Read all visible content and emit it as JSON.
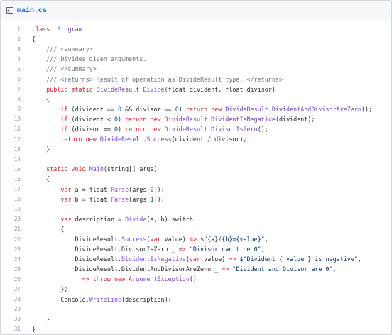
{
  "file": {
    "name": "main.cs",
    "icon": "code-file-icon"
  },
  "colors": {
    "keyword": "#cf222e",
    "type": "#6f42c1",
    "comment": "#6e7781",
    "string": "#0a3069",
    "line_number": "#8c959f"
  },
  "lines": [
    {
      "n": "1",
      "tokens": [
        [
          "kw",
          "class"
        ],
        [
          "",
          "  "
        ],
        [
          "ty",
          "Program"
        ]
      ]
    },
    {
      "n": "2",
      "tokens": [
        [
          "",
          "{"
        ]
      ]
    },
    {
      "n": "3",
      "tokens": [
        [
          "",
          "    "
        ],
        [
          "cm",
          "/// <summary>"
        ]
      ]
    },
    {
      "n": "4",
      "tokens": [
        [
          "",
          "    "
        ],
        [
          "cm",
          "/// Divides given arguments."
        ]
      ]
    },
    {
      "n": "5",
      "tokens": [
        [
          "",
          "    "
        ],
        [
          "cm",
          "/// </summary>"
        ]
      ]
    },
    {
      "n": "6",
      "tokens": [
        [
          "",
          "    "
        ],
        [
          "cm",
          "/// <returns> Result of operation as DivideResult type. </returns>"
        ]
      ]
    },
    {
      "n": "7",
      "tokens": [
        [
          "",
          "    "
        ],
        [
          "kw",
          "public static"
        ],
        [
          "",
          " "
        ],
        [
          "ty",
          "DivideResult"
        ],
        [
          "",
          " "
        ],
        [
          "fn",
          "Divide"
        ],
        [
          "",
          "(float divident, float divisor)"
        ]
      ]
    },
    {
      "n": "8",
      "tokens": [
        [
          "",
          "    {"
        ]
      ]
    },
    {
      "n": "9",
      "tokens": [
        [
          "",
          "        "
        ],
        [
          "kw",
          "if"
        ],
        [
          "",
          " (divident == "
        ],
        [
          "kw2",
          "0"
        ],
        [
          "",
          " && divisor == "
        ],
        [
          "kw2",
          "0"
        ],
        [
          "",
          ") "
        ],
        [
          "kw",
          "return new"
        ],
        [
          "",
          " "
        ],
        [
          "ty",
          "DivideResult"
        ],
        [
          "",
          "."
        ],
        [
          "ty",
          "DividentAndDivisorAreZero"
        ],
        [
          "",
          "();"
        ]
      ]
    },
    {
      "n": "10",
      "tokens": [
        [
          "",
          "        "
        ],
        [
          "kw",
          "if"
        ],
        [
          "",
          " (divident < "
        ],
        [
          "kw2",
          "0"
        ],
        [
          "",
          ") "
        ],
        [
          "kw",
          "return new"
        ],
        [
          "",
          " "
        ],
        [
          "ty",
          "DivideResult"
        ],
        [
          "",
          "."
        ],
        [
          "ty",
          "DividentIsNegative"
        ],
        [
          "",
          "(divident);"
        ]
      ]
    },
    {
      "n": "11",
      "tokens": [
        [
          "",
          "        "
        ],
        [
          "kw",
          "if"
        ],
        [
          "",
          " (divisor == "
        ],
        [
          "kw2",
          "0"
        ],
        [
          "",
          ") "
        ],
        [
          "kw",
          "return new"
        ],
        [
          "",
          " "
        ],
        [
          "ty",
          "DivideResult"
        ],
        [
          "",
          "."
        ],
        [
          "ty",
          "DivisorIsZero"
        ],
        [
          "",
          "();"
        ]
      ]
    },
    {
      "n": "12",
      "tokens": [
        [
          "",
          "        "
        ],
        [
          "kw",
          "return new"
        ],
        [
          "",
          " "
        ],
        [
          "ty",
          "DivideResult"
        ],
        [
          "",
          "."
        ],
        [
          "ty",
          "Success"
        ],
        [
          "",
          "(divident / divisor);"
        ]
      ]
    },
    {
      "n": "13",
      "tokens": [
        [
          "",
          "    }"
        ]
      ]
    },
    {
      "n": "14",
      "tokens": []
    },
    {
      "n": "15",
      "tokens": [
        [
          "",
          "    "
        ],
        [
          "kw",
          "static void"
        ],
        [
          "",
          " "
        ],
        [
          "fn",
          "Main"
        ],
        [
          "",
          "(string[] args)"
        ]
      ]
    },
    {
      "n": "16",
      "tokens": [
        [
          "",
          "    {"
        ]
      ]
    },
    {
      "n": "17",
      "tokens": [
        [
          "",
          "        "
        ],
        [
          "kw",
          "var"
        ],
        [
          "",
          " a = float."
        ],
        [
          "fn",
          "Parse"
        ],
        [
          "",
          "(args["
        ],
        [
          "kw2",
          "0"
        ],
        [
          "",
          "]);"
        ]
      ]
    },
    {
      "n": "18",
      "tokens": [
        [
          "",
          "        "
        ],
        [
          "kw",
          "var"
        ],
        [
          "",
          " b = float."
        ],
        [
          "fn",
          "Parse"
        ],
        [
          "",
          "(args["
        ],
        [
          "kw2",
          "1"
        ],
        [
          "",
          "]);"
        ]
      ]
    },
    {
      "n": "19",
      "tokens": []
    },
    {
      "n": "20",
      "tokens": [
        [
          "",
          "        "
        ],
        [
          "kw",
          "var"
        ],
        [
          "",
          " description = "
        ],
        [
          "fn",
          "Divide"
        ],
        [
          "",
          "(a, b) switch"
        ]
      ]
    },
    {
      "n": "21",
      "tokens": [
        [
          "",
          "        {"
        ]
      ]
    },
    {
      "n": "22",
      "tokens": [
        [
          "",
          "            DivideResult."
        ],
        [
          "fn",
          "Success"
        ],
        [
          "",
          "("
        ],
        [
          "kw",
          "var"
        ],
        [
          "",
          " value) "
        ],
        [
          "kw",
          "=>"
        ],
        [
          "",
          " "
        ],
        [
          "st",
          "$\"{a}/{b}={value}\""
        ],
        [
          "",
          ","
        ]
      ]
    },
    {
      "n": "23",
      "tokens": [
        [
          "",
          "            DivideResult.DivisorIsZero _ "
        ],
        [
          "kw",
          "=>"
        ],
        [
          "",
          " "
        ],
        [
          "st",
          "\"Divisor can't be 0\""
        ],
        [
          "",
          ","
        ]
      ]
    },
    {
      "n": "24",
      "tokens": [
        [
          "",
          "            DivideResult."
        ],
        [
          "fn",
          "DividentIsNegative"
        ],
        [
          "",
          "("
        ],
        [
          "kw",
          "var"
        ],
        [
          "",
          " value) "
        ],
        [
          "kw",
          "=>"
        ],
        [
          "",
          " "
        ],
        [
          "st",
          "$\"Divident { value } is negative\""
        ],
        [
          "",
          ","
        ]
      ]
    },
    {
      "n": "25",
      "tokens": [
        [
          "",
          "            DivideResult.DividentAndDivisorAreZero _ "
        ],
        [
          "kw",
          "=>"
        ],
        [
          "",
          " "
        ],
        [
          "st",
          "\"Divident and Divisor are 0\""
        ],
        [
          "",
          ","
        ]
      ]
    },
    {
      "n": "26",
      "tokens": [
        [
          "",
          "            _ "
        ],
        [
          "kw",
          "=> throw new"
        ],
        [
          "",
          " "
        ],
        [
          "ty",
          "ArgumentException"
        ],
        [
          "",
          "()"
        ]
      ]
    },
    {
      "n": "27",
      "tokens": [
        [
          "",
          "        };"
        ]
      ]
    },
    {
      "n": "28",
      "tokens": [
        [
          "",
          "        Console."
        ],
        [
          "fn",
          "WriteLine"
        ],
        [
          "",
          "(description);"
        ]
      ]
    },
    {
      "n": "29",
      "tokens": []
    },
    {
      "n": "30",
      "tokens": [
        [
          "",
          "    }"
        ]
      ]
    },
    {
      "n": "31",
      "tokens": [
        [
          "",
          "}"
        ]
      ]
    }
  ]
}
